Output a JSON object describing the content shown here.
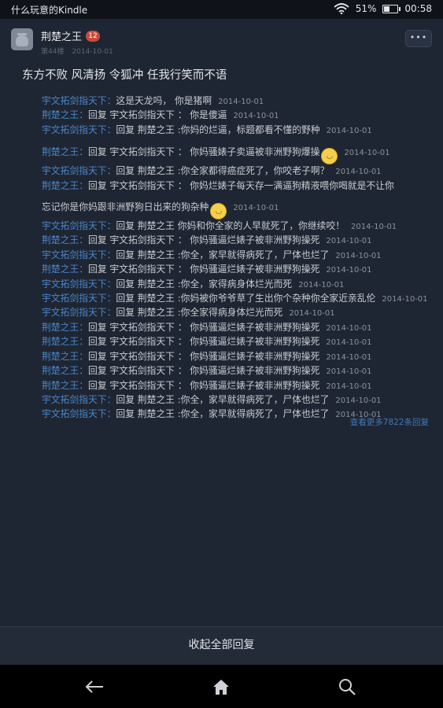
{
  "status_bar": {
    "app_name": "什么玩意的Kindle",
    "battery": "51%",
    "battery_level": 0.51,
    "time": "00:58"
  },
  "post": {
    "author": "荆楚之王",
    "level_badge": "12",
    "floor": "第44楼",
    "date": "2014-10-01",
    "content": "东方不败 风清扬 令狐冲 任我行笑而不语"
  },
  "replies": [
    {
      "name": "宇文拓剑指天下",
      "sep": "：",
      "text": "这是天龙吗， 你是猪啊",
      "date": "2014-10-01"
    },
    {
      "name": "荆楚之王",
      "sep": "：",
      "text": "回复 宇文拓剑指天下 ： 你是傻逼",
      "date": "2014-10-01"
    },
    {
      "name": "宇文拓剑指天下",
      "sep": "：",
      "text": "回复 荆楚之王 :你妈的烂逼，标题都看不懂的野种",
      "date": "2014-10-01"
    },
    {
      "name": "荆楚之王",
      "sep": "：",
      "text": "回复 宇文拓剑指天下 ： 你妈骚婊子卖逼被非洲野狗爆操",
      "date": "2014-10-01",
      "emoji": true,
      "gap_before": true
    },
    {
      "name": "宇文拓剑指天下",
      "sep": "：",
      "text": "回复 荆楚之王 :你全家都得癌症死了，你咬老子啊？",
      "date": "2014-10-01"
    },
    {
      "name": "荆楚之王",
      "sep": "：",
      "text": "回复 宇文拓剑指天下 ： 你妈烂婊子每天存一满逼狗精液喂你喝就是不让你",
      "date": ""
    },
    {
      "name": "",
      "sep": "",
      "text": "忘记你是你妈跟非洲野狗日出来的狗杂种",
      "date": "2014-10-01",
      "emoji": true,
      "gap_before": true
    },
    {
      "name": "宇文拓剑指天下",
      "sep": "：",
      "text": "回复 荆楚之王 你妈和你全家的人早就死了，你继续咬！",
      "date": "2014-10-01"
    },
    {
      "name": "荆楚之王",
      "sep": "：",
      "text": "回复 宇文拓剑指天下 ： 你妈骚逼烂婊子被非洲野狗操死",
      "date": "2014-10-01"
    },
    {
      "name": "宇文拓剑指天下",
      "sep": "：",
      "text": "回复 荆楚之王 :你全，家早就得病死了，尸体也烂了",
      "date": "2014-10-01"
    },
    {
      "name": "荆楚之王",
      "sep": "：",
      "text": "回复 宇文拓剑指天下 ： 你妈骚逼烂婊子被非洲野狗操死",
      "date": "2014-10-01"
    },
    {
      "name": "宇文拓剑指天下",
      "sep": "：",
      "text": "回复 荆楚之王 :你全，家得病身体烂光而死",
      "date": "2014-10-01"
    },
    {
      "name": "宇文拓剑指天下",
      "sep": "：",
      "text": "回复 荆楚之王 :你妈被你爷爷草了生出你个杂种你全家近亲乱伦",
      "date": "2014-10-01",
      "wrap": true
    },
    {
      "name": "宇文拓剑指天下",
      "sep": "：",
      "text": "回复 荆楚之王 :你全家得病身体烂光而死",
      "date": "2014-10-01"
    },
    {
      "name": "荆楚之王",
      "sep": "：",
      "text": "回复 宇文拓剑指天下 ： 你妈骚逼烂婊子被非洲野狗操死",
      "date": "2014-10-01"
    },
    {
      "name": "荆楚之王",
      "sep": "：",
      "text": "回复 宇文拓剑指天下 ： 你妈骚逼烂婊子被非洲野狗操死",
      "date": "2014-10-01"
    },
    {
      "name": "荆楚之王",
      "sep": "：",
      "text": "回复 宇文拓剑指天下 ： 你妈骚逼烂婊子被非洲野狗操死",
      "date": "2014-10-01"
    },
    {
      "name": "荆楚之王",
      "sep": "：",
      "text": "回复 宇文拓剑指天下 ： 你妈骚逼烂婊子被非洲野狗操死",
      "date": "2014-10-01"
    },
    {
      "name": "荆楚之王",
      "sep": "：",
      "text": "回复 宇文拓剑指天下 ： 你妈骚逼烂婊子被非洲野狗操死",
      "date": "2014-10-01"
    },
    {
      "name": "宇文拓剑指天下",
      "sep": "：",
      "text": "回复 荆楚之王 :你全，家早就得病死了，尸体也烂了",
      "date": "2014-10-01"
    },
    {
      "name": "宇文拓剑指天下",
      "sep": "：",
      "text": "回复 荆楚之王 :你全，家早就得病死了，尸体也烂了",
      "date": "2014-10-01"
    }
  ],
  "see_more": "查看更多7822条回复",
  "collapse_label": "收起全部回复",
  "nav": {
    "back": "back-icon",
    "home": "home-icon",
    "search": "search-icon"
  },
  "colors": {
    "background": "#1f2633",
    "link": "#4a86c7",
    "badge": "#c84a3b"
  }
}
